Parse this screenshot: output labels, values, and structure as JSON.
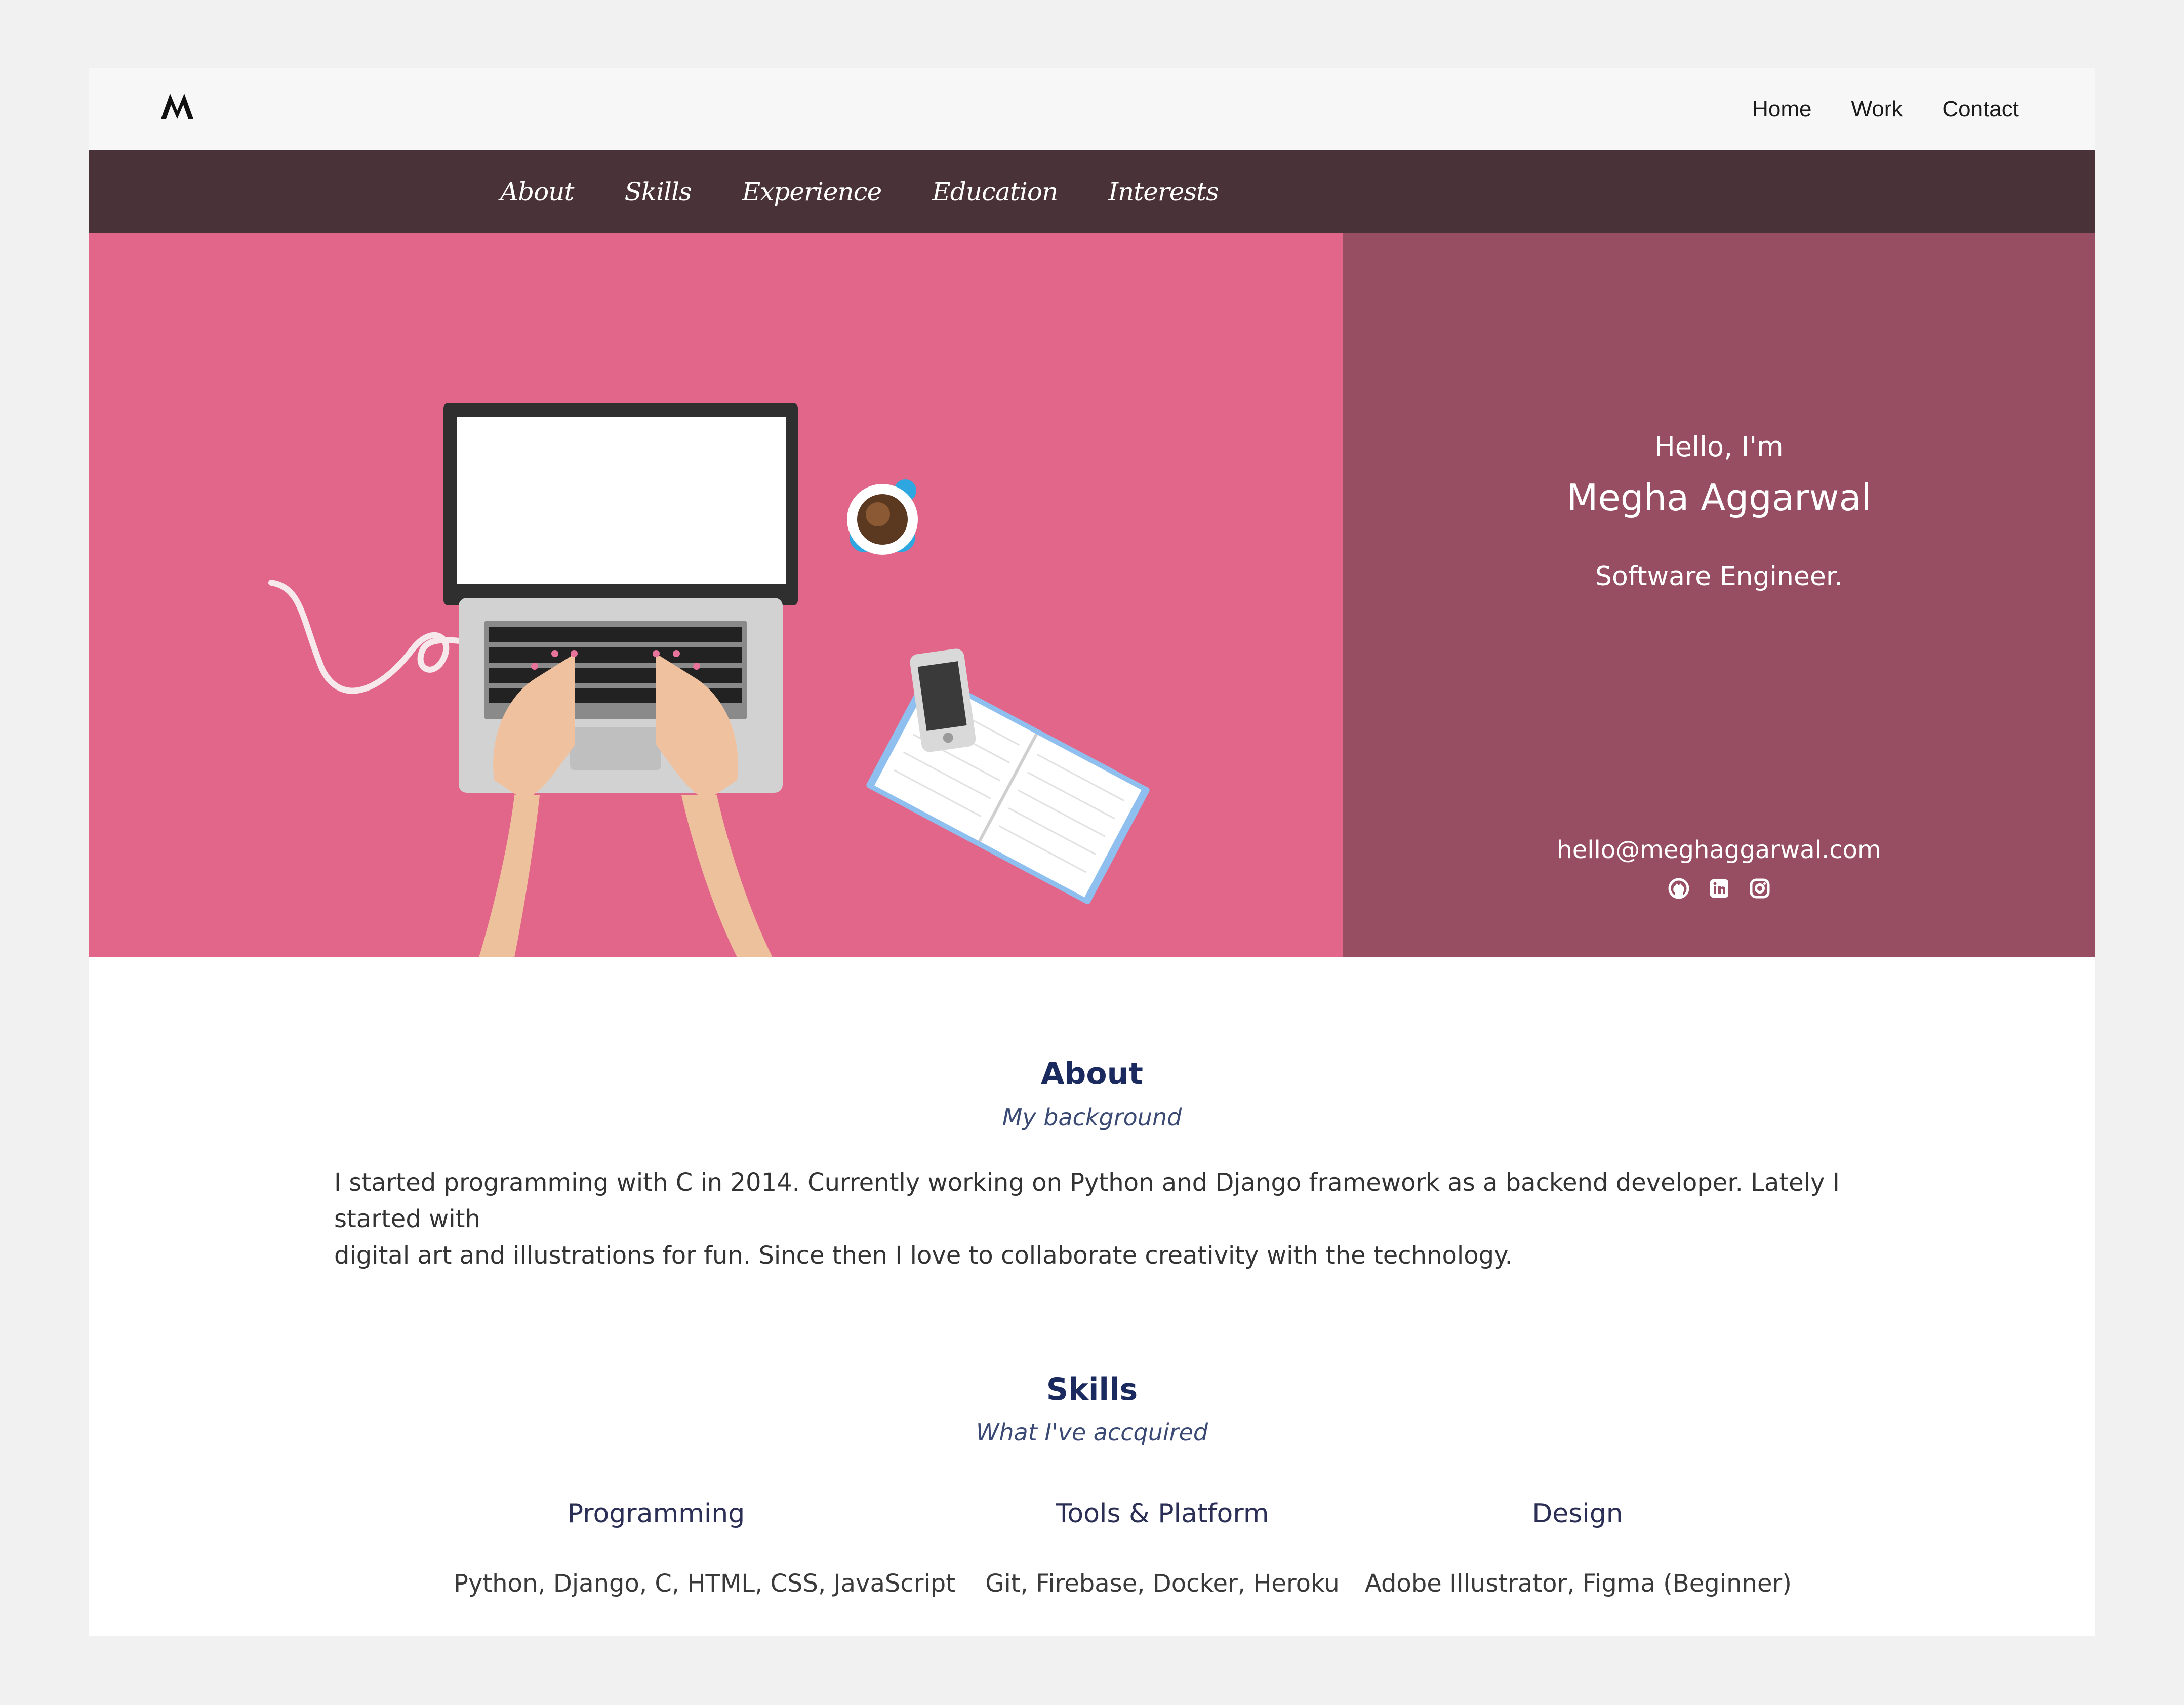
{
  "header": {
    "logo_text": "M",
    "nav": [
      "Home",
      "Work",
      "Contact"
    ]
  },
  "section_nav": [
    "About",
    "Skills",
    "Experience",
    "Education",
    "Interests"
  ],
  "hero": {
    "greeting": "Hello, I'm",
    "name": "Megha Aggarwal",
    "role": "Software Engineer.",
    "email": "hello@meghaggarwal.com",
    "social_icons": [
      "github-icon",
      "linkedin-icon",
      "instagram-icon"
    ],
    "colors": {
      "left": "#e1668a",
      "right": "#974e62",
      "nav": "#4a3239"
    }
  },
  "about": {
    "title": "About",
    "subtitle": "My background",
    "text_line1": "I started programming with C in 2014. Currently working on Python and Django framework as a backend developer. Lately I started with",
    "text_line2": "digital art and illustrations for fun. Since then I love to collaborate creativity with the technology."
  },
  "skills": {
    "title": "Skills",
    "subtitle": "What I've accquired",
    "columns": [
      {
        "title": "Programming",
        "items": "Python, Django, C, HTML, CSS, JavaScript"
      },
      {
        "title": "Tools & Platform",
        "items": "Git, Firebase, Docker, Heroku"
      },
      {
        "title": "Design",
        "items": "Adobe Illustrator, Figma (Beginner)"
      }
    ]
  }
}
